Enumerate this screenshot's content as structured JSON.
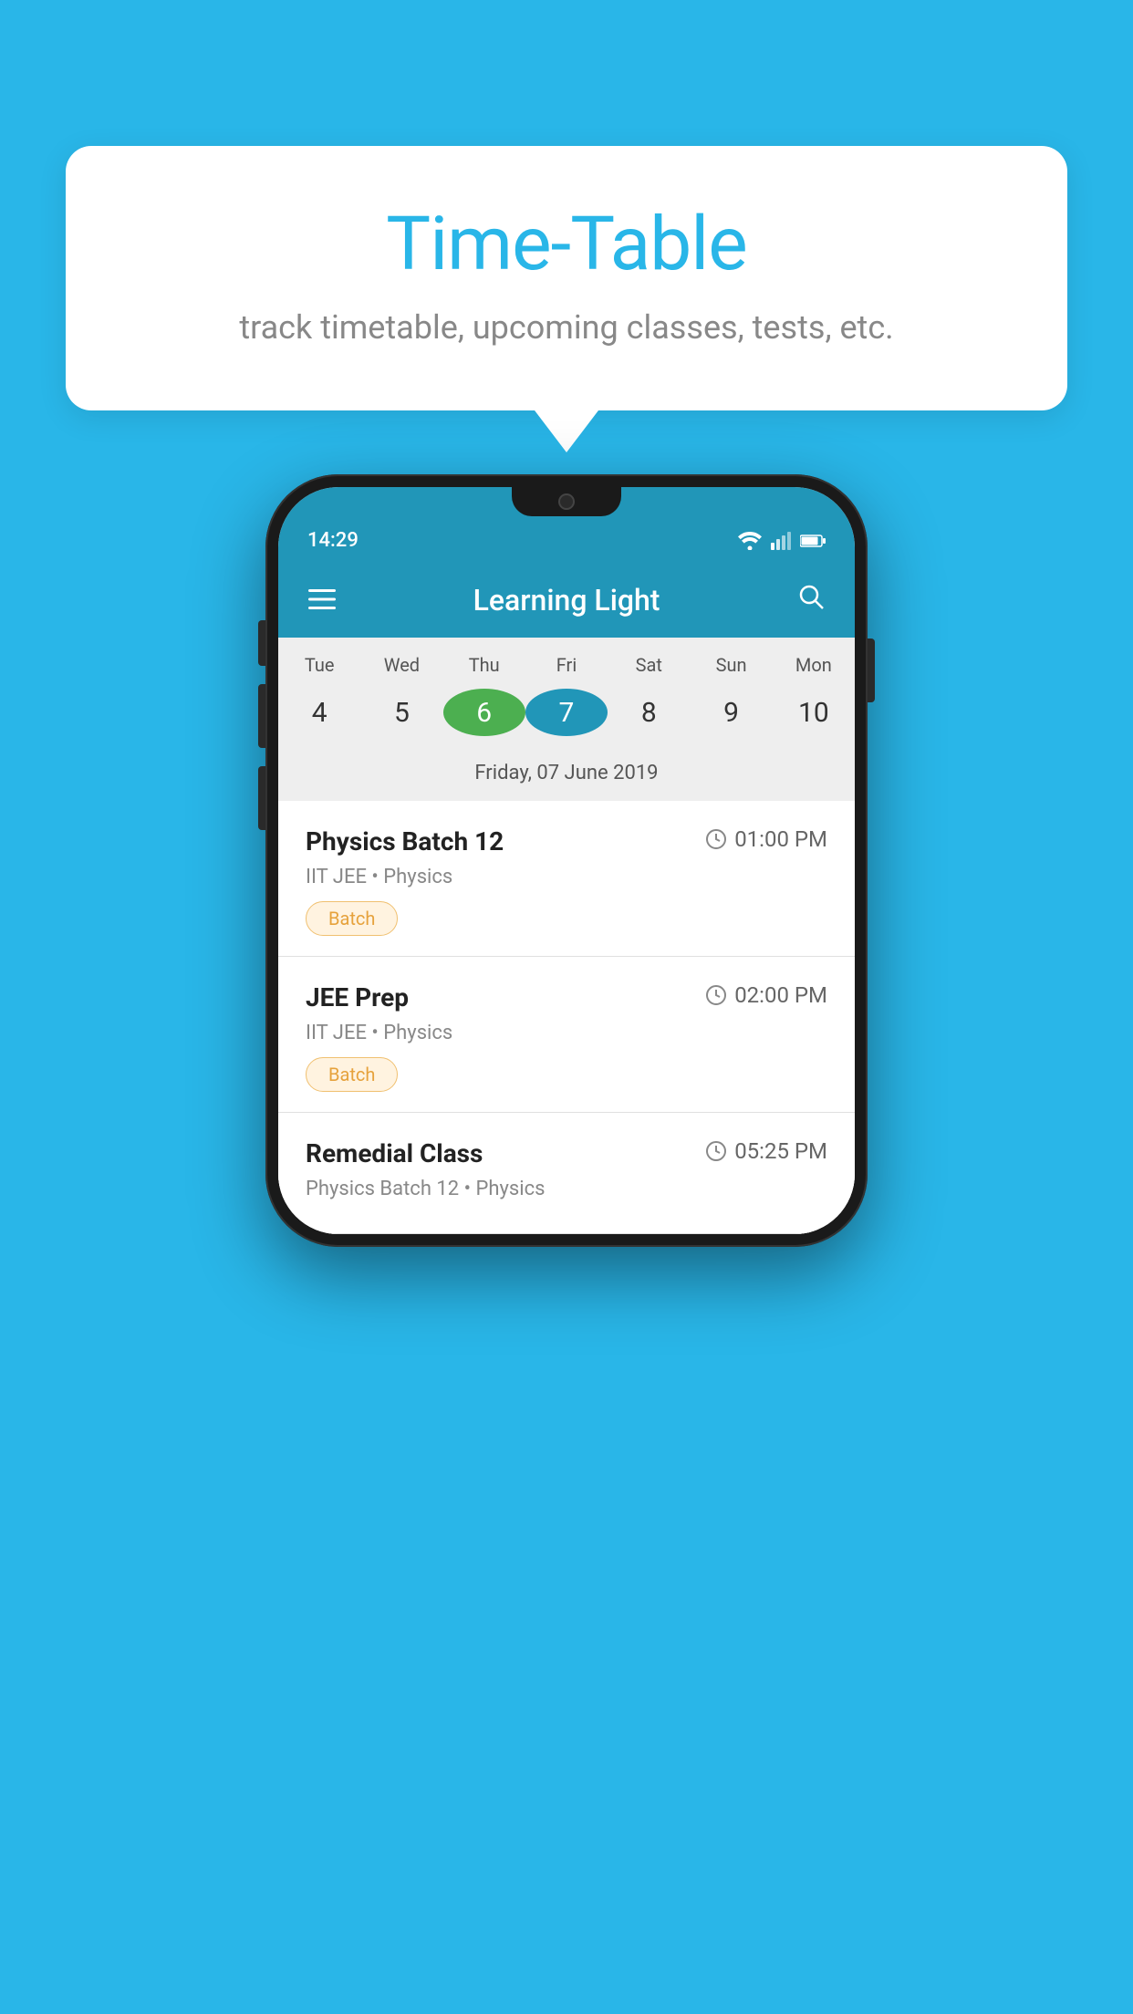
{
  "background_color": "#29b6e8",
  "speech_bubble": {
    "title": "Time-Table",
    "subtitle": "track timetable, upcoming classes, tests, etc."
  },
  "phone": {
    "status_bar": {
      "time": "14:29",
      "icons": [
        "wifi",
        "signal",
        "battery"
      ]
    },
    "app_bar": {
      "title": "Learning Light",
      "menu_icon": "≡",
      "search_icon": "🔍"
    },
    "calendar": {
      "days": [
        {
          "label": "Tue",
          "num": "4",
          "state": "normal"
        },
        {
          "label": "Wed",
          "num": "5",
          "state": "normal"
        },
        {
          "label": "Thu",
          "num": "6",
          "state": "today"
        },
        {
          "label": "Fri",
          "num": "7",
          "state": "selected"
        },
        {
          "label": "Sat",
          "num": "8",
          "state": "normal"
        },
        {
          "label": "Sun",
          "num": "9",
          "state": "normal"
        },
        {
          "label": "Mon",
          "num": "10",
          "state": "normal"
        }
      ],
      "selected_date_label": "Friday, 07 June 2019"
    },
    "classes": [
      {
        "name": "Physics Batch 12",
        "time": "01:00 PM",
        "meta": "IIT JEE • Physics",
        "tag": "Batch"
      },
      {
        "name": "JEE Prep",
        "time": "02:00 PM",
        "meta": "IIT JEE • Physics",
        "tag": "Batch"
      },
      {
        "name": "Remedial Class",
        "time": "05:25 PM",
        "meta": "Physics Batch 12 • Physics",
        "tag": ""
      }
    ]
  }
}
